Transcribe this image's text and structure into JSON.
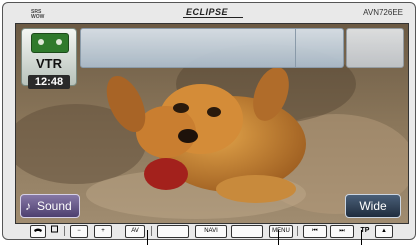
{
  "header": {
    "brand_small_line1": "SRS",
    "brand_small_line2": "WOW",
    "brand": "ECLIPSE",
    "model": "AVN726EE"
  },
  "screen": {
    "source_label": "VTR",
    "clock": "12:48",
    "sound_label": "Sound",
    "wide_label": "Wide"
  },
  "buttons": {
    "minus": "−",
    "plus": "+",
    "av": "AV",
    "navi": "NAVI",
    "menu": "MENU",
    "prev": "⏮",
    "next": "⏭",
    "tp": "TP",
    "eject": "▲"
  },
  "icons": [
    "phone-icon",
    "square-icon",
    "music-note-icon",
    "eject-icon"
  ]
}
